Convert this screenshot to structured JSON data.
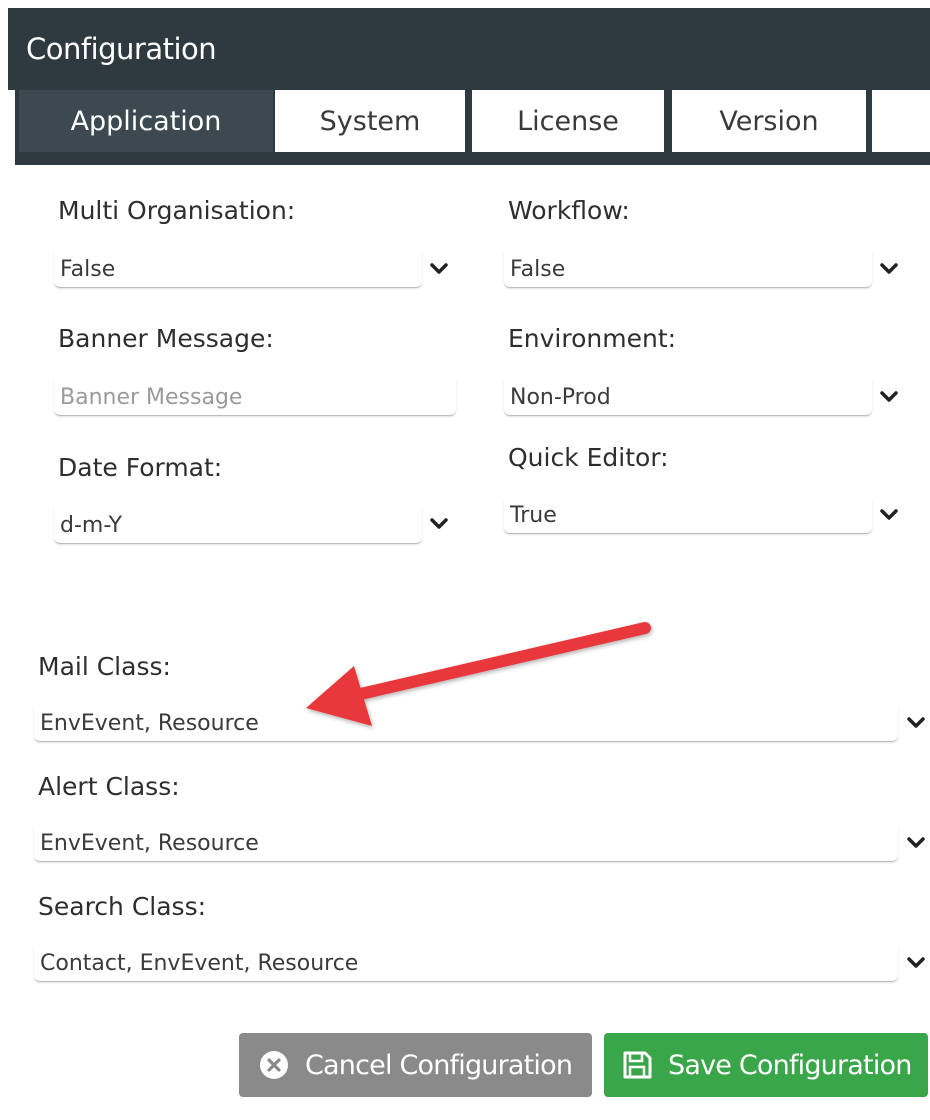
{
  "window": {
    "title": "Configuration"
  },
  "tabs": [
    {
      "label": "Application",
      "active": true
    },
    {
      "label": "System",
      "active": false
    },
    {
      "label": "License",
      "active": false
    },
    {
      "label": "Version",
      "active": false
    }
  ],
  "fields": {
    "multi_organisation": {
      "label": "Multi Organisation:",
      "value": "False"
    },
    "workflow": {
      "label": "Workflow:",
      "value": "False"
    },
    "banner_message": {
      "label": "Banner Message:",
      "value": "",
      "placeholder": "Banner Message"
    },
    "environment": {
      "label": "Environment:",
      "value": "Non-Prod"
    },
    "date_format": {
      "label": "Date Format:",
      "value": "d-m-Y"
    },
    "quick_editor": {
      "label": "Quick Editor:",
      "value": "True"
    },
    "mail_class": {
      "label": "Mail Class:",
      "value": "EnvEvent, Resource"
    },
    "alert_class": {
      "label": "Alert Class:",
      "value": "EnvEvent, Resource"
    },
    "search_class": {
      "label": "Search Class:",
      "value": "Contact, EnvEvent, Resource"
    }
  },
  "buttons": {
    "cancel": {
      "label": "Cancel Configuration",
      "icon": "close-circle-icon"
    },
    "save": {
      "label": "Save Configuration",
      "icon": "floppy-disk-icon"
    }
  },
  "colors": {
    "header_bg": "#2f3a40",
    "active_tab": "#3d4950",
    "cancel_button": "#8a8a8a",
    "save_button": "#3aa64a",
    "annotation_arrow": "#e8373a"
  }
}
